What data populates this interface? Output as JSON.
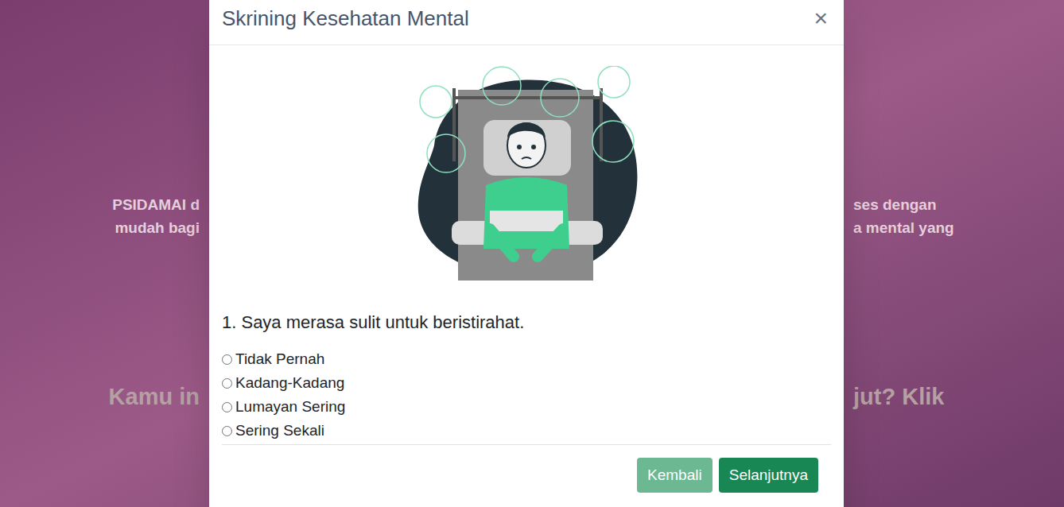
{
  "background": {
    "rows": [
      {
        "left": "PSIDAMAI d",
        "right": "ses dengan",
        "kind": "body"
      },
      {
        "left": "mudah bagi",
        "right": "a mental yang",
        "kind": "body"
      },
      {
        "left": "Kamu in",
        "right": "jut? Klik",
        "kind": "headline"
      }
    ]
  },
  "modal": {
    "title": "Skrining Kesehatan Mental",
    "close": "×",
    "question": "1. Saya merasa sulit untuk beristirahat.",
    "options": [
      {
        "label": "Tidak Pernah",
        "selected": false
      },
      {
        "label": "Kadang-Kadang",
        "selected": false
      },
      {
        "label": "Lumayan Sering",
        "selected": false
      },
      {
        "label": "Sering Sekali",
        "selected": false
      }
    ],
    "buttons": [
      {
        "label": "Kembali",
        "disabled": true
      },
      {
        "label": "Selanjutnya",
        "disabled": false
      }
    ]
  }
}
